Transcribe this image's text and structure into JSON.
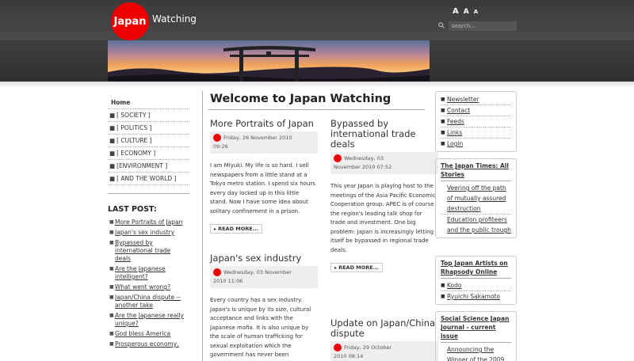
{
  "header": {
    "logo_mark": "Japan",
    "logo_text": "Watching",
    "font_controls": {
      "increase": "A",
      "reset": "A",
      "decrease": "A"
    },
    "search_placeholder": "search..."
  },
  "left_nav": [
    {
      "label": "Home",
      "bullet": ""
    },
    {
      "label": "[ SOCIETY ]",
      "bullet": "■"
    },
    {
      "label": "[ POLITICS ]",
      "bullet": "■"
    },
    {
      "label": "[ CULTURE ]",
      "bullet": "■"
    },
    {
      "label": "[ ECONOMY ]",
      "bullet": "■"
    },
    {
      "label": "[ENVIRONMENT ]",
      "bullet": "■"
    },
    {
      "label": "[ AND THE WORLD ]",
      "bullet": "■"
    }
  ],
  "last_post": {
    "heading": "LAST POST:",
    "items": [
      "More Portraits of Japan",
      "Japan's sex industry",
      "Bypassed by international trade deals",
      "Are the Japanese intelligent?",
      "What went wrong?",
      "Japan/China dispute -- another take",
      "Are the Japanese really unique?",
      "God bless America",
      "Prosperous economy,"
    ]
  },
  "main": {
    "title": "Welcome to Japan Watching",
    "read_more": "READ MORE...",
    "articles": [
      {
        "title": "More Portraits of Japan",
        "date": "Friday, 26 November 2010",
        "time": "09:26",
        "body": "I am Miyuki.  My life is so hard.  I sell newspapers from a little stand at a Tokyo metro station.  I spend six hours every day locked up in this little stand. Now I have some idea about solitary confinement in a prison."
      },
      {
        "title": "Japan's sex industry",
        "date": "Wednesday, 03 November",
        "time": "2010 11:06",
        "body": "Every country has a sex industry.  Japan's is unique by its size, cultural acceptance and links with the Japanese mafia.  It is also unique by the scale of human trafficking for sexual exploitation which the government has never been"
      },
      {
        "title": "Bypassed by international trade deals",
        "date": "Wednesday, 03",
        "time": "November 2010 07:52",
        "body": "This year Japan is playing host to the meetings of the Asia Pacific Economic Cooperation group.  APEC is of course the region's leading talk shop for trade and investment.  One big problem: Japan is increasingly letting itself be bypassed in regional trade deals."
      },
      {
        "title": "Update on Japan/China dispute",
        "date": "Friday, 29 October",
        "time": "2010 08:14",
        "body": ""
      }
    ]
  },
  "right": {
    "links": [
      "Newsletter",
      "Contact",
      "Feeds",
      "Links",
      "Login"
    ],
    "boxes": [
      {
        "heading": "The Japan Times: All Stories",
        "items": [
          "Veering off the path of mutually assured destruction",
          "Education profiteers and the public trough"
        ]
      },
      {
        "heading": "Top Japan Artists on Rhapsody Online",
        "items": [
          "Kodo",
          "Ryuichi Sakamoto"
        ]
      },
      {
        "heading": "Social Science Japan Journal - current issue",
        "items": [
          "Announcing the Winner of the 2009"
        ]
      }
    ]
  }
}
